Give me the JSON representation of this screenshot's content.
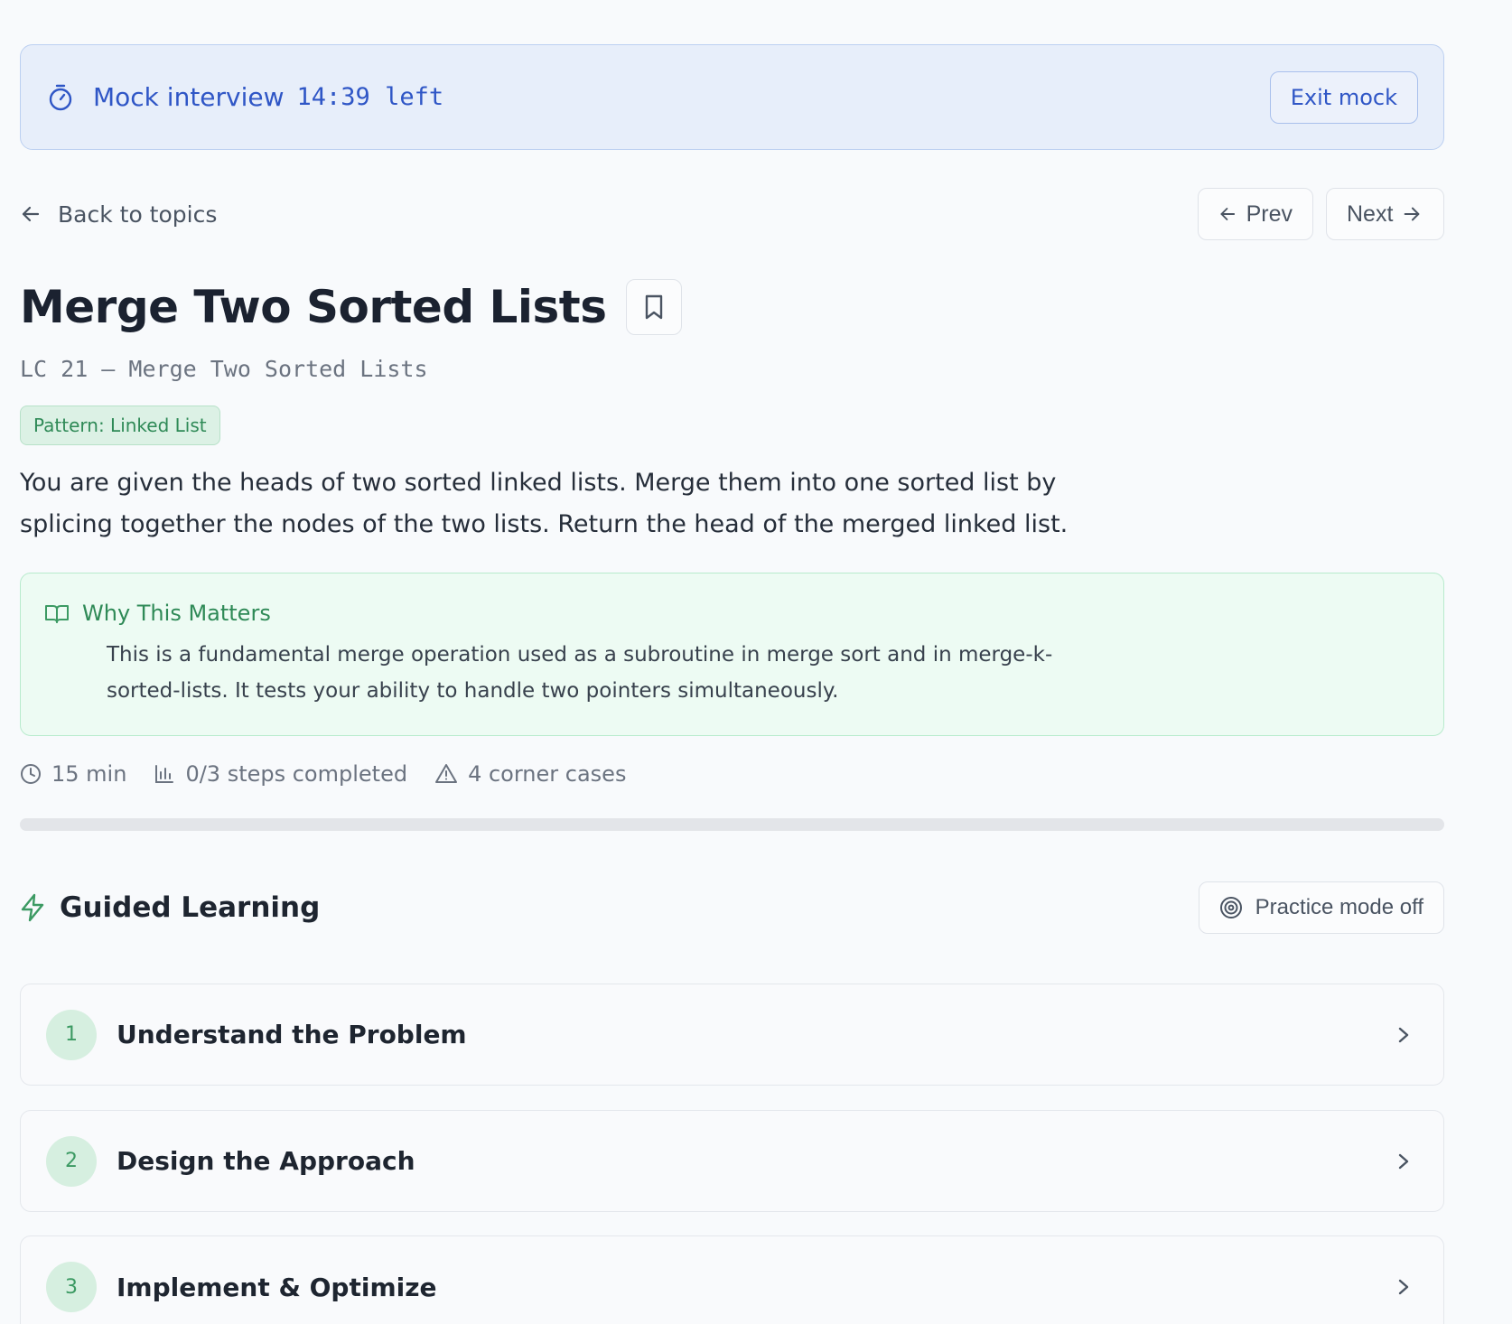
{
  "mock": {
    "title": "Mock interview",
    "time_left": "14:39 left",
    "exit_label": "Exit mock",
    "icon": "stopwatch-icon"
  },
  "nav": {
    "back_label": "Back to topics",
    "prev_label": "Prev",
    "next_label": "Next"
  },
  "problem": {
    "title": "Merge Two Sorted Lists",
    "subtitle": "LC 21 – Merge Two Sorted Lists",
    "pattern": "Pattern: Linked List",
    "description": "You are given the heads of two sorted linked lists. Merge them into one sorted list by splicing together the nodes of the two lists. Return the head of the merged linked list."
  },
  "why": {
    "title": "Why This Matters",
    "body": "This is a fundamental merge operation used as a subroutine in merge sort and in merge-k-sorted-lists. It tests your ability to handle two pointers simultaneously."
  },
  "stats": {
    "time": "15 min",
    "steps": "0/3 steps completed",
    "corner_cases": "4 corner cases",
    "progress_fraction": 0
  },
  "guided": {
    "title": "Guided Learning",
    "practice_label": "Practice mode off",
    "steps": [
      {
        "num": "1",
        "label": "Understand the Problem"
      },
      {
        "num": "2",
        "label": "Design the Approach"
      },
      {
        "num": "3",
        "label": "Implement & Optimize"
      }
    ]
  },
  "colors": {
    "accent_blue": "#2f56c6",
    "accent_green": "#3ba56a",
    "background": "#f8fafc"
  }
}
